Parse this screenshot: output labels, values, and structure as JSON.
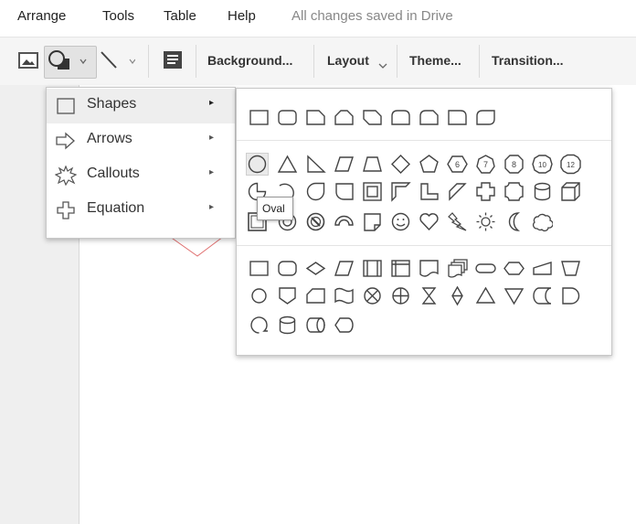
{
  "menubar": {
    "items": [
      "Arrange",
      "Tools",
      "Table",
      "Help"
    ],
    "save_status": "All changes saved in Drive"
  },
  "toolbar": {
    "background_label": "Background...",
    "layout_label": "Layout",
    "theme_label": "Theme...",
    "transition_label": "Transition..."
  },
  "insert_menu": {
    "items": [
      {
        "label": "Shapes",
        "icon": "rectangle-icon",
        "arrow": "▸"
      },
      {
        "label": "Arrows",
        "icon": "arrow-icon",
        "arrow": "▸"
      },
      {
        "label": "Callouts",
        "icon": "explosion-icon",
        "arrow": "▸"
      },
      {
        "label": "Equation",
        "icon": "plus-icon",
        "arrow": "▸"
      }
    ]
  },
  "palette": {
    "badge_numbers": [
      "6",
      "7",
      "8",
      "10",
      "12"
    ]
  },
  "tooltip": {
    "text": "Oval"
  },
  "colors": {
    "accent": "#4d90fe",
    "toolbar_bg": "#f5f5f5",
    "shape_stroke": "#444444"
  }
}
